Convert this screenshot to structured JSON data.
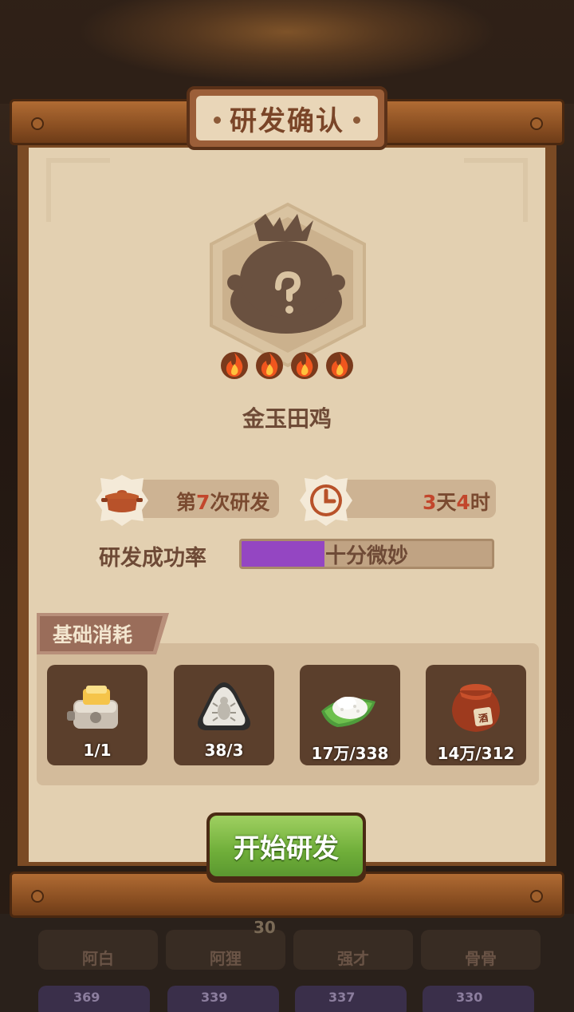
{
  "dialog": {
    "title": "研发确认",
    "dish_name": "金玉田鸡",
    "difficulty_flames": 4,
    "research_count": {
      "prefix": "第",
      "number": "7",
      "suffix": "次研发"
    },
    "duration": {
      "days": "3",
      "day_unit": "天",
      "hours": "4",
      "hour_unit": "时"
    },
    "success_rate": {
      "label": "研发成功率",
      "text": "十分微妙",
      "fill_fraction": 0.33,
      "color": "#9446c2"
    },
    "consumption": {
      "title": "基础消耗",
      "items": [
        {
          "icon": "toaster-icon",
          "count": "1/1"
        },
        {
          "icon": "bug-rice-ball-icon",
          "count": "38/3"
        },
        {
          "icon": "rice-on-leaf-icon",
          "count": "17万/338"
        },
        {
          "icon": "wine-jar-icon",
          "count": "14万/312"
        }
      ]
    },
    "start_button": "开始研发"
  },
  "background": {
    "characters": [
      "阿白",
      "阿狸",
      "强才",
      "骨骨"
    ],
    "levels": [
      "369",
      "339",
      "337",
      "330"
    ],
    "badge_number": "30"
  }
}
